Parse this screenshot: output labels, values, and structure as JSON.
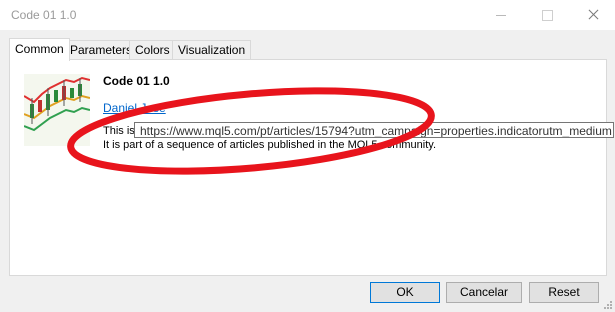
{
  "window": {
    "title": "Code 01 1.0"
  },
  "tabs": [
    {
      "label": "Common",
      "active": true
    },
    {
      "label": "Parameters",
      "active": false
    },
    {
      "label": "Colors",
      "active": false
    },
    {
      "label": "Visualization",
      "active": false
    }
  ],
  "common": {
    "indicator_name": "Code 01 1.0",
    "author": "Daniel Jose",
    "description_line1": "This is",
    "description_line2": "It is part of a sequence of articles published in the MQL5 community."
  },
  "tooltip": {
    "url": "https://www.mql5.com/pt/articles/15794?utm_campaign=properties.indicatorutm_medium"
  },
  "buttons": {
    "ok": "OK",
    "cancel": "Cancelar",
    "reset": "Reset"
  },
  "colors": {
    "annotation_ring": "#e8141c",
    "link": "#0066cc",
    "ok_focus_border": "#0078d7"
  },
  "icons": [
    "indicator-icon",
    "minimize-icon",
    "maximize-icon",
    "close-icon",
    "resize-grip-icon"
  ]
}
